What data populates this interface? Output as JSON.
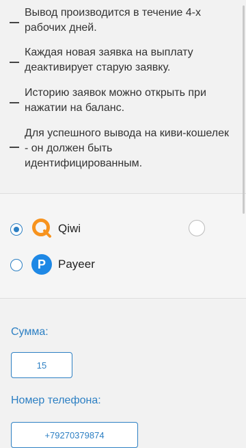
{
  "rules": [
    "Вывод производится в течение 4-х рабочих дней.",
    "Каждая новая заявка на выплату деактивирует старую заявку.",
    "Историю заявок можно открыть при нажатии на баланс.",
    "Для успешного вывода на киви-кошелек - он должен быть идентифицированным."
  ],
  "methods": [
    {
      "label": "Qiwi",
      "selected": true,
      "icon": "qiwi-logo",
      "color": "#f7931e"
    },
    {
      "label": "Payeer",
      "selected": false,
      "icon": "payeer-logo",
      "color": "#1e88e5"
    }
  ],
  "form": {
    "amount_label": "Сумма:",
    "amount_value": "15",
    "phone_label": "Номер телефона:",
    "phone_value": "+79270379874"
  },
  "colors": {
    "accent": "#2c7fc3"
  }
}
